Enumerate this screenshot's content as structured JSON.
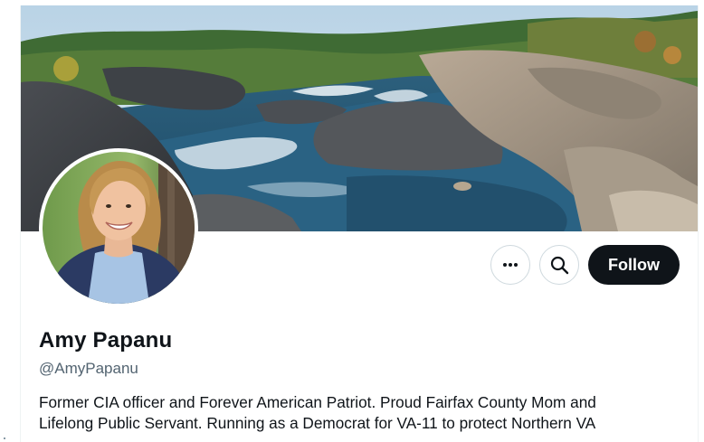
{
  "profile": {
    "display_name": "Amy Papanu",
    "handle": "@AmyPapanu",
    "bio_lines": [
      "Former CIA officer and Forever American Patriot. Proud Fairfax County Mom and",
      "Lifelong Public Servant. Running as a Democrat for VA-11 to protect Northern VA"
    ]
  },
  "actions": {
    "more_icon": "more-horizontal-icon",
    "search_icon": "search-icon",
    "follow_label": "Follow"
  },
  "colors": {
    "follow_bg": "#0f1419",
    "handle_text": "#536471",
    "button_border": "#cfd9de"
  }
}
